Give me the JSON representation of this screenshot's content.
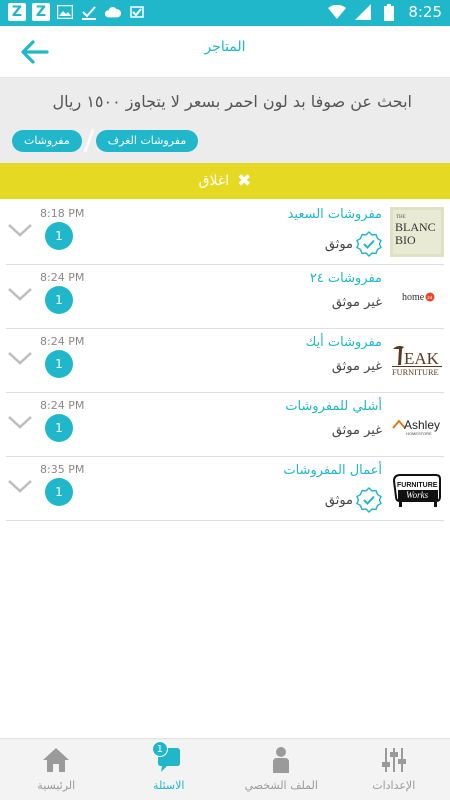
{
  "status_bar": {
    "time": "8:25",
    "left_icons": [
      "z-app-icon",
      "z-app-icon",
      "image-icon",
      "check-icon",
      "cloud-icon",
      "check-icon"
    ],
    "right_icons": [
      "wifi-icon",
      "signal-icon",
      "battery-icon"
    ]
  },
  "header": {
    "title": "المتاجر",
    "back_icon": "arrow-left-icon"
  },
  "question": {
    "text": "ابحث عن صوفا بد لون احمر بسعر لا يتجاوز ١٥٠٠ ريال",
    "tags": [
      "مفروشات الغرف",
      "مفروشات"
    ]
  },
  "close_bar": {
    "label": "اغلاق",
    "icon": "close-icon"
  },
  "stores": [
    {
      "name": "مفروشات السعيد",
      "status": "موثق",
      "verified": true,
      "time": "8:18 PM",
      "count": "1",
      "logo_text": "THE BLANC BIO"
    },
    {
      "name": "مفروشات ٢٤",
      "status": "غير موثق",
      "verified": false,
      "time": "8:24 PM",
      "count": "1",
      "logo_text": "home24"
    },
    {
      "name": "مفروشات أيك",
      "status": "غير موثق",
      "verified": false,
      "time": "8:24 PM",
      "count": "1",
      "logo_text": "TEAK FURNITURE"
    },
    {
      "name": "أشلي للمفروشات",
      "status": "غير موثق",
      "verified": false,
      "time": "8:24 PM",
      "count": "1",
      "logo_text": "Ashley HOMESTORE"
    },
    {
      "name": "أعمال المفروشات",
      "status": "موثق",
      "verified": true,
      "time": "8:35 PM",
      "count": "1",
      "logo_text": "FURNITURE WORKS"
    }
  ],
  "bottom_nav": {
    "items": [
      {
        "label": "الرئيسية",
        "icon": "home-icon",
        "active": false
      },
      {
        "label": "الاسئلة",
        "icon": "chat-icon",
        "active": true,
        "badge": "1"
      },
      {
        "label": "الملف الشخصي",
        "icon": "person-icon",
        "active": false
      },
      {
        "label": "الإعدادات",
        "icon": "sliders-icon",
        "active": false
      }
    ]
  },
  "colors": {
    "accent": "#1fb7c9",
    "close_bar": "#e6d923",
    "panel": "#ececec"
  }
}
